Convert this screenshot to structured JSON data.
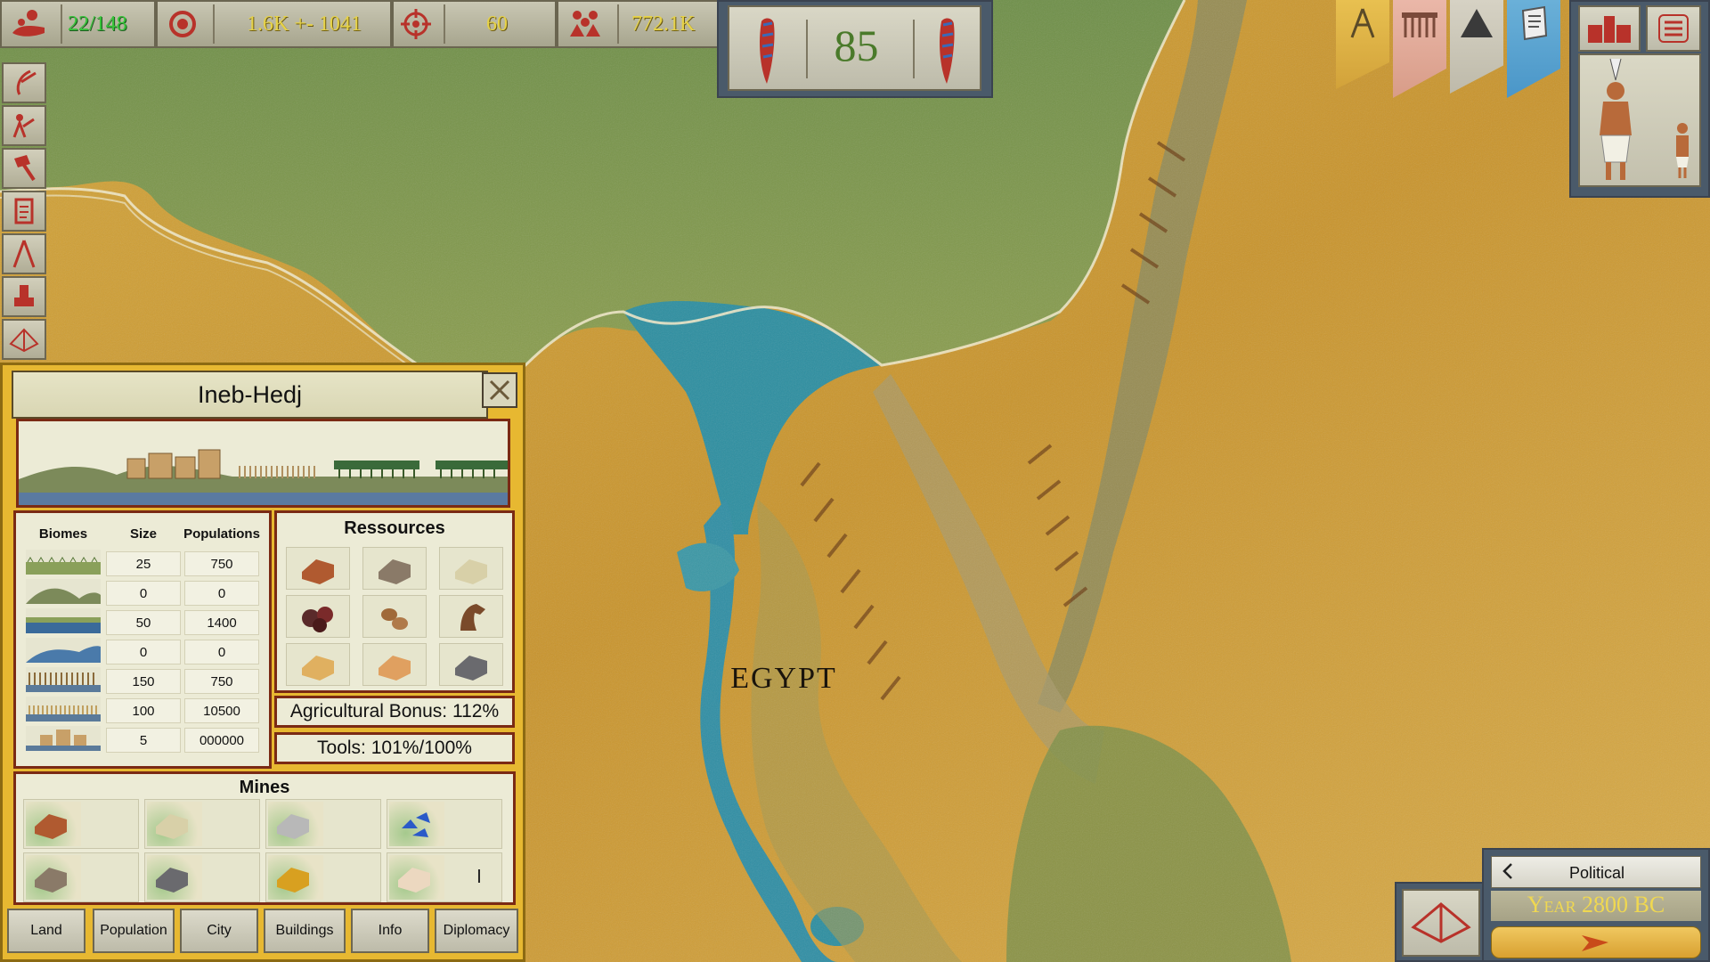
{
  "top_bar": {
    "population": "22/148",
    "wealth": "1.6K +- 1041",
    "military": "60",
    "total": "772.1K",
    "turn_counter": "85"
  },
  "map": {
    "region_label": "EGYPT"
  },
  "city_panel": {
    "name": "Ineb-Hedj",
    "biome_headers": [
      "Biomes",
      "Size",
      "Populations"
    ],
    "biomes": [
      {
        "icon": "grassland-icon",
        "size": "25",
        "populations": "750"
      },
      {
        "icon": "hills-icon",
        "size": "0",
        "populations": "0"
      },
      {
        "icon": "river-icon",
        "size": "50",
        "populations": "1400"
      },
      {
        "icon": "coast-icon",
        "size": "0",
        "populations": "0"
      },
      {
        "icon": "wheat-field-icon",
        "size": "150",
        "populations": "750"
      },
      {
        "icon": "farmland-icon",
        "size": "100",
        "populations": "10500"
      },
      {
        "icon": "city-icon",
        "size": "5",
        "populations": "000000"
      }
    ],
    "resources_title": "Ressources",
    "resources": [
      "copper-icon",
      "stone-icon",
      "limestone-icon",
      "ore-icon",
      "wood-icon",
      "horse-icon",
      "sandstone-icon",
      "clay-icon",
      "granite-icon"
    ],
    "agricultural_bonus": "Agricultural Bonus: 112%",
    "tools": "Tools: 101%/100%",
    "mines_title": "Mines",
    "mines": [
      "copper-mine-icon",
      "limestone-mine-icon",
      "silver-mine-icon",
      "lapis-mine-icon",
      "stone-mine-icon",
      "granite-mine-icon",
      "gold-mine-icon",
      "alabaster-mine-icon"
    ],
    "tabs": [
      "Land",
      "Population",
      "City",
      "Buildings",
      "Info",
      "Diplomacy"
    ]
  },
  "map_mode": {
    "label": "Political",
    "year": "Year 2800 BC"
  },
  "colors": {
    "panel_gold": "#e7b831",
    "border_red": "#7a2a14",
    "turn_green": "#4a7a2a"
  }
}
